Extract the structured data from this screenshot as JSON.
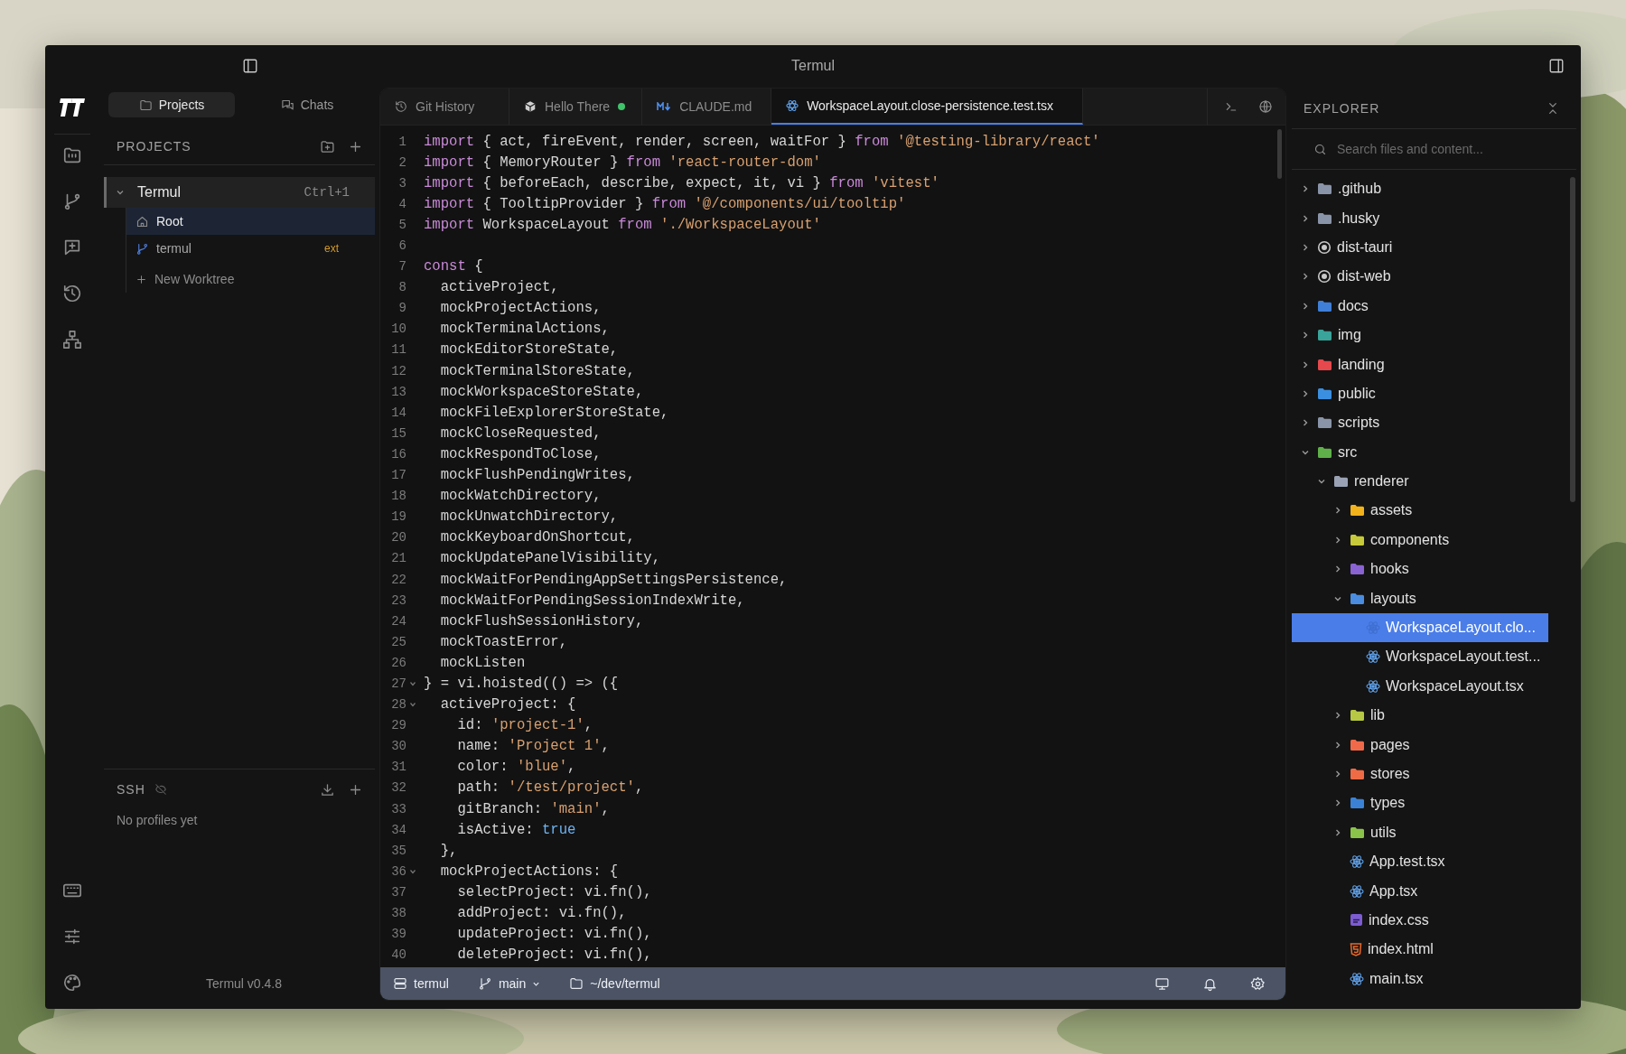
{
  "window": {
    "title": "Termul"
  },
  "sidebar": {
    "tabs": [
      {
        "label": "Projects",
        "kind": "projects",
        "selected": true
      },
      {
        "label": "Chats",
        "kind": "chats",
        "selected": false
      }
    ],
    "projects_heading": "PROJECTS",
    "project": {
      "name": "Termul",
      "shortcut": "Ctrl+1",
      "expanded": true,
      "worktrees": [
        {
          "name": "Root",
          "kind": "root",
          "selected": true
        },
        {
          "name": "termul",
          "kind": "branch",
          "badge": "ext",
          "selected": false
        }
      ],
      "add_label": "New Worktree"
    },
    "ssh": {
      "heading": "SSH",
      "empty": "No profiles yet"
    },
    "version": "Termul v0.4.8"
  },
  "editor": {
    "tabs": [
      {
        "label": "Git History",
        "kind": "history",
        "status_dot": false,
        "selected": false
      },
      {
        "label": "Hello There",
        "kind": "cube",
        "status_dot": true,
        "selected": false
      },
      {
        "label": "CLAUDE.md",
        "kind": "markdown",
        "status_dot": false,
        "selected": false
      },
      {
        "label": "WorkspaceLayout.close-persistence.test.tsx",
        "kind": "react",
        "status_dot": false,
        "selected": true
      }
    ],
    "lines": [
      {
        "number": "1",
        "fold": false,
        "tokens": [
          {
            "kind": "kw",
            "text": "import"
          },
          {
            "kind": "plain",
            "text": " { act, fireEvent, render, screen, waitFor } "
          },
          {
            "kind": "kw",
            "text": "from"
          },
          {
            "kind": "str",
            "text": " '@testing-library/react'"
          }
        ]
      },
      {
        "number": "2",
        "fold": false,
        "tokens": [
          {
            "kind": "kw",
            "text": "import"
          },
          {
            "kind": "plain",
            "text": " { MemoryRouter } "
          },
          {
            "kind": "kw",
            "text": "from"
          },
          {
            "kind": "str",
            "text": " 'react-router-dom'"
          }
        ]
      },
      {
        "number": "3",
        "fold": false,
        "tokens": [
          {
            "kind": "kw",
            "text": "import"
          },
          {
            "kind": "plain",
            "text": " { beforeEach, describe, expect, it, vi } "
          },
          {
            "kind": "kw",
            "text": "from"
          },
          {
            "kind": "str",
            "text": " 'vitest'"
          }
        ]
      },
      {
        "number": "4",
        "fold": false,
        "tokens": [
          {
            "kind": "kw",
            "text": "import"
          },
          {
            "kind": "plain",
            "text": " { TooltipProvider } "
          },
          {
            "kind": "kw",
            "text": "from"
          },
          {
            "kind": "str",
            "text": " '@/components/ui/tooltip'"
          }
        ]
      },
      {
        "number": "5",
        "fold": false,
        "tokens": [
          {
            "kind": "kw",
            "text": "import"
          },
          {
            "kind": "plain",
            "text": " WorkspaceLayout "
          },
          {
            "kind": "kw",
            "text": "from"
          },
          {
            "kind": "str",
            "text": " './WorkspaceLayout'"
          }
        ]
      },
      {
        "number": "6",
        "fold": false
      },
      {
        "number": "7",
        "fold": false,
        "tokens": [
          {
            "kind": "kw",
            "text": "const"
          },
          {
            "kind": "plain",
            "text": " {"
          }
        ]
      },
      {
        "number": "8",
        "fold": false,
        "tokens": [
          {
            "kind": "plain",
            "text": "  activeProject,"
          }
        ]
      },
      {
        "number": "9",
        "fold": false,
        "tokens": [
          {
            "kind": "plain",
            "text": "  mockProjectActions,"
          }
        ]
      },
      {
        "number": "10",
        "fold": false,
        "tokens": [
          {
            "kind": "plain",
            "text": "  mockTerminalActions,"
          }
        ]
      },
      {
        "number": "11",
        "fold": false,
        "tokens": [
          {
            "kind": "plain",
            "text": "  mockEditorStoreState,"
          }
        ]
      },
      {
        "number": "12",
        "fold": false,
        "tokens": [
          {
            "kind": "plain",
            "text": "  mockTerminalStoreState,"
          }
        ]
      },
      {
        "number": "13",
        "fold": false,
        "tokens": [
          {
            "kind": "plain",
            "text": "  mockWorkspaceStoreState,"
          }
        ]
      },
      {
        "number": "14",
        "fold": false,
        "tokens": [
          {
            "kind": "plain",
            "text": "  mockFileExplorerStoreState,"
          }
        ]
      },
      {
        "number": "15",
        "fold": false,
        "tokens": [
          {
            "kind": "plain",
            "text": "  mockCloseRequested,"
          }
        ]
      },
      {
        "number": "16",
        "fold": false,
        "tokens": [
          {
            "kind": "plain",
            "text": "  mockRespondToClose,"
          }
        ]
      },
      {
        "number": "17",
        "fold": false,
        "tokens": [
          {
            "kind": "plain",
            "text": "  mockFlushPendingWrites,"
          }
        ]
      },
      {
        "number": "18",
        "fold": false,
        "tokens": [
          {
            "kind": "plain",
            "text": "  mockWatchDirectory,"
          }
        ]
      },
      {
        "number": "19",
        "fold": false,
        "tokens": [
          {
            "kind": "plain",
            "text": "  mockUnwatchDirectory,"
          }
        ]
      },
      {
        "number": "20",
        "fold": false,
        "tokens": [
          {
            "kind": "plain",
            "text": "  mockKeyboardOnShortcut,"
          }
        ]
      },
      {
        "number": "21",
        "fold": false,
        "tokens": [
          {
            "kind": "plain",
            "text": "  mockUpdatePanelVisibility,"
          }
        ]
      },
      {
        "number": "22",
        "fold": false,
        "tokens": [
          {
            "kind": "plain",
            "text": "  mockWaitForPendingAppSettingsPersistence,"
          }
        ]
      },
      {
        "number": "23",
        "fold": false,
        "tokens": [
          {
            "kind": "plain",
            "text": "  mockWaitForPendingSessionIndexWrite,"
          }
        ]
      },
      {
        "number": "24",
        "fold": false,
        "tokens": [
          {
            "kind": "plain",
            "text": "  mockFlushSessionHistory,"
          }
        ]
      },
      {
        "number": "25",
        "fold": false,
        "tokens": [
          {
            "kind": "plain",
            "text": "  mockToastError,"
          }
        ]
      },
      {
        "number": "26",
        "fold": false,
        "tokens": [
          {
            "kind": "plain",
            "text": "  mockListen"
          }
        ]
      },
      {
        "number": "27",
        "fold": true,
        "tokens": [
          {
            "kind": "plain",
            "text": "} = vi.hoisted(() => ({"
          }
        ]
      },
      {
        "number": "28",
        "fold": true,
        "tokens": [
          {
            "kind": "plain",
            "text": "  activeProject: {"
          }
        ]
      },
      {
        "number": "29",
        "fold": false,
        "tokens": [
          {
            "kind": "plain",
            "text": "    id: "
          },
          {
            "kind": "str",
            "text": "'project-1'"
          },
          {
            "kind": "plain",
            "text": ","
          }
        ]
      },
      {
        "number": "30",
        "fold": false,
        "tokens": [
          {
            "kind": "plain",
            "text": "    name: "
          },
          {
            "kind": "str",
            "text": "'Project 1'"
          },
          {
            "kind": "plain",
            "text": ","
          }
        ]
      },
      {
        "number": "31",
        "fold": false,
        "tokens": [
          {
            "kind": "plain",
            "text": "    color: "
          },
          {
            "kind": "str",
            "text": "'blue'"
          },
          {
            "kind": "plain",
            "text": ","
          }
        ]
      },
      {
        "number": "32",
        "fold": false,
        "tokens": [
          {
            "kind": "plain",
            "text": "    path: "
          },
          {
            "kind": "str",
            "text": "'/test/project'"
          },
          {
            "kind": "plain",
            "text": ","
          }
        ]
      },
      {
        "number": "33",
        "fold": false,
        "tokens": [
          {
            "kind": "plain",
            "text": "    gitBranch: "
          },
          {
            "kind": "str",
            "text": "'main'"
          },
          {
            "kind": "plain",
            "text": ","
          }
        ]
      },
      {
        "number": "34",
        "fold": false,
        "tokens": [
          {
            "kind": "plain",
            "text": "    isActive: "
          },
          {
            "kind": "bool",
            "text": "true"
          }
        ]
      },
      {
        "number": "35",
        "fold": false,
        "tokens": [
          {
            "kind": "plain",
            "text": "  },"
          }
        ]
      },
      {
        "number": "36",
        "fold": true,
        "tokens": [
          {
            "kind": "plain",
            "text": "  mockProjectActions: {"
          }
        ]
      },
      {
        "number": "37",
        "fold": false,
        "tokens": [
          {
            "kind": "plain",
            "text": "    selectProject: vi.fn(),"
          }
        ]
      },
      {
        "number": "38",
        "fold": false,
        "tokens": [
          {
            "kind": "plain",
            "text": "    addProject: vi.fn(),"
          }
        ]
      },
      {
        "number": "39",
        "fold": false,
        "tokens": [
          {
            "kind": "plain",
            "text": "    updateProject: vi.fn(),"
          }
        ]
      },
      {
        "number": "40",
        "fold": false,
        "tokens": [
          {
            "kind": "plain",
            "text": "    deleteProject: vi.fn(),"
          }
        ]
      }
    ]
  },
  "status_bar": {
    "items": [
      {
        "kind": "server",
        "label": "termul",
        "dropdown": false
      },
      {
        "kind": "branch",
        "label": "main",
        "dropdown": true
      },
      {
        "kind": "folder",
        "label": "~/dev/termul",
        "dropdown": false
      }
    ]
  },
  "explorer": {
    "title": "EXPLORER",
    "search": {
      "placeholder": "Search files and content..."
    },
    "tree": [
      {
        "name": ".github",
        "kind": "folder",
        "color": "#8a94a8",
        "expanded": false,
        "selected": false
      },
      {
        "name": ".husky",
        "kind": "folder",
        "color": "#8a94a8",
        "expanded": false,
        "selected": false
      },
      {
        "name": "dist-tauri",
        "kind": "dist",
        "expanded": false,
        "selected": false
      },
      {
        "name": "dist-web",
        "kind": "dist",
        "expanded": false,
        "selected": false
      },
      {
        "name": "docs",
        "kind": "folder",
        "color": "#3f7fd8",
        "expanded": false,
        "selected": false
      },
      {
        "name": "img",
        "kind": "folder",
        "color": "#3aa39a",
        "expanded": false,
        "selected": false
      },
      {
        "name": "landing",
        "kind": "folder",
        "color": "#e5484d",
        "expanded": false,
        "selected": false
      },
      {
        "name": "public",
        "kind": "folder",
        "color": "#3b8fe0",
        "expanded": false,
        "selected": false
      },
      {
        "name": "scripts",
        "kind": "folder",
        "color": "#8a94a8",
        "expanded": false,
        "selected": false
      },
      {
        "name": "src",
        "kind": "folder",
        "color": "#5fb04a",
        "expanded": true,
        "selected": false,
        "children": [
          {
            "name": "renderer",
            "kind": "folder",
            "color": "#9aa3b5",
            "expanded": true,
            "selected": false,
            "children": [
              {
                "name": "assets",
                "kind": "folder",
                "color": "#f2b21c",
                "expanded": false,
                "selected": false
              },
              {
                "name": "components",
                "kind": "folder",
                "color": "#c6c93a",
                "expanded": false,
                "selected": false
              },
              {
                "name": "hooks",
                "kind": "folder",
                "color": "#8a63d2",
                "expanded": false,
                "selected": false
              },
              {
                "name": "layouts",
                "kind": "folder",
                "color": "#4a8de0",
                "expanded": true,
                "selected": false,
                "children": [
                  {
                    "name": "WorkspaceLayout.clo...",
                    "kind": "react",
                    "selected": true
                  },
                  {
                    "name": "WorkspaceLayout.test...",
                    "kind": "react",
                    "selected": false
                  },
                  {
                    "name": "WorkspaceLayout.tsx",
                    "kind": "react",
                    "selected": false
                  }
                ]
              },
              {
                "name": "lib",
                "kind": "folder",
                "color": "#b7c844",
                "expanded": false,
                "selected": false
              },
              {
                "name": "pages",
                "kind": "folder",
                "color": "#f06a4a",
                "expanded": false,
                "selected": false
              },
              {
                "name": "stores",
                "kind": "folder",
                "color": "#ef6b45",
                "expanded": false,
                "selected": false
              },
              {
                "name": "types",
                "kind": "folder",
                "color": "#3b82d6",
                "expanded": false,
                "selected": false
              },
              {
                "name": "utils",
                "kind": "folder",
                "color": "#8bc34a",
                "expanded": false,
                "selected": false
              },
              {
                "name": "App.test.tsx",
                "kind": "react",
                "selected": false
              },
              {
                "name": "App.tsx",
                "kind": "react",
                "selected": false
              },
              {
                "name": "index.css",
                "kind": "css",
                "selected": false
              },
              {
                "name": "index.html",
                "kind": "html",
                "selected": false
              },
              {
                "name": "main.tsx",
                "kind": "react",
                "selected": false
              }
            ]
          }
        ]
      }
    ]
  }
}
